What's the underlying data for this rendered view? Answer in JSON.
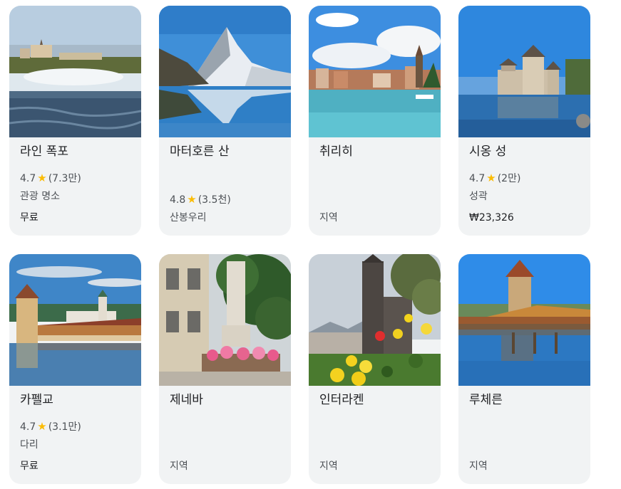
{
  "cards": [
    {
      "title": "라인 폭포",
      "rating": "4.7",
      "reviews": "(7.3만)",
      "category": "관광 명소",
      "price": "무료",
      "image": "waterfall-photo"
    },
    {
      "title": "마터호른 산",
      "rating": "4.8",
      "reviews": "(3.5천)",
      "category": "산봉우리",
      "price": "",
      "image": "matterhorn-photo"
    },
    {
      "title": "취리히",
      "rating": "",
      "reviews": "",
      "category": "지역",
      "price": "",
      "image": "lakeside-town-photo"
    },
    {
      "title": "시옹 성",
      "rating": "4.7",
      "reviews": "(2만)",
      "category": "성곽",
      "price": "₩23,326",
      "image": "castle-photo"
    },
    {
      "title": "카펠교",
      "rating": "4.7",
      "reviews": "(3.1만)",
      "category": "다리",
      "price": "무료",
      "image": "chapel-bridge-photo"
    },
    {
      "title": "제네바",
      "rating": "",
      "reviews": "",
      "category": "지역",
      "price": "",
      "image": "fountain-photo"
    },
    {
      "title": "인터라켄",
      "rating": "",
      "reviews": "",
      "category": "지역",
      "price": "",
      "image": "church-flowers-photo"
    },
    {
      "title": "루체른",
      "rating": "",
      "reviews": "",
      "category": "지역",
      "price": "",
      "image": "bridge-tower-photo"
    }
  ],
  "colors": {
    "card_bg": "#f1f3f4",
    "star": "#fbbc04",
    "title": "#202124",
    "meta": "#4d5156"
  }
}
